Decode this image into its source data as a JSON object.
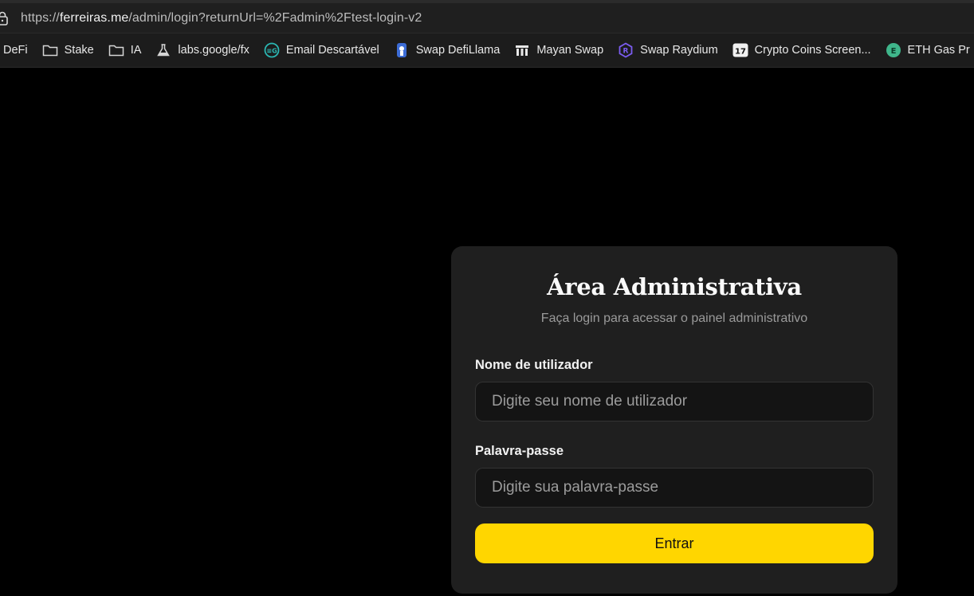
{
  "browser": {
    "url_prefix": "https://",
    "url_host": "ferreiras.me",
    "url_path": "/admin/login?returnUrl=%2Fadmin%2Ftest-login-v2",
    "bookmarks": [
      {
        "label": "DeFi",
        "icon": "none"
      },
      {
        "label": "Stake",
        "icon": "folder-icon"
      },
      {
        "label": "IA",
        "icon": "folder-icon"
      },
      {
        "label": "labs.google/fx",
        "icon": "flask-icon"
      },
      {
        "label": "Email Descartável",
        "icon": "email-logo-icon"
      },
      {
        "label": "Swap DefiLlama",
        "icon": "llama-icon"
      },
      {
        "label": "Mayan Swap",
        "icon": "mayan-icon"
      },
      {
        "label": "Swap Raydium",
        "icon": "raydium-icon"
      },
      {
        "label": "Crypto Coins Screen...",
        "icon": "tradingview-icon"
      },
      {
        "label": "ETH Gas Pr",
        "icon": "gas-icon"
      }
    ]
  },
  "login": {
    "title": "Área Administrativa",
    "subtitle": "Faça login para acessar o painel administrativo",
    "username_label": "Nome de utilizador",
    "username_placeholder": "Digite seu nome de utilizador",
    "password_label": "Palavra-passe",
    "password_placeholder": "Digite sua palavra-passe",
    "submit_label": "Entrar"
  },
  "colors": {
    "accent": "#ffd600",
    "card_bg": "#1f1f1f",
    "page_bg": "#000000"
  }
}
